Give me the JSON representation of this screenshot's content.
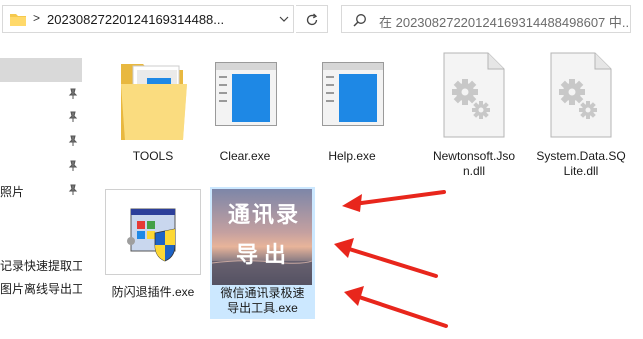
{
  "address": {
    "path_text": "20230827220124169314488...",
    "separator": ">",
    "search_placeholder": "在 20230827220124169314488498607 中..."
  },
  "nav": {
    "items": [
      {
        "label": ""
      },
      {
        "label": ""
      },
      {
        "label": ""
      },
      {
        "label": ""
      },
      {
        "label": "照片"
      },
      {
        "label": "记录快速提取工"
      },
      {
        "label": "图片离线导出工"
      }
    ]
  },
  "files": [
    {
      "name_line1": "TOOLS",
      "name_line2": "",
      "icon": "folder-icon"
    },
    {
      "name_line1": "Clear.exe",
      "name_line2": "",
      "icon": "exe-window-icon"
    },
    {
      "name_line1": "Help.exe",
      "name_line2": "",
      "icon": "exe-window-icon"
    },
    {
      "name_line1": "Newtonsoft.Jso",
      "name_line2": "n.dll",
      "icon": "dll-gear-icon"
    },
    {
      "name_line1": "System.Data.SQ",
      "name_line2": "Lite.dll",
      "icon": "dll-gear-icon"
    },
    {
      "name_line1": "防闪退插件.exe",
      "name_line2": "",
      "icon": "installer-shield-icon"
    },
    {
      "name_line1": "微信通讯录极速",
      "name_line2": "导出工具.exe",
      "icon": "app-thumbnail-icon",
      "thumb_line1": "通讯录",
      "thumb_line2": "导出"
    }
  ],
  "colors": {
    "selection": "#cce8ff",
    "nav_selected": "#d9d9d9",
    "arrow": "#e8261c",
    "folder": "#f5c94e",
    "window_blue": "#1e88e5"
  }
}
